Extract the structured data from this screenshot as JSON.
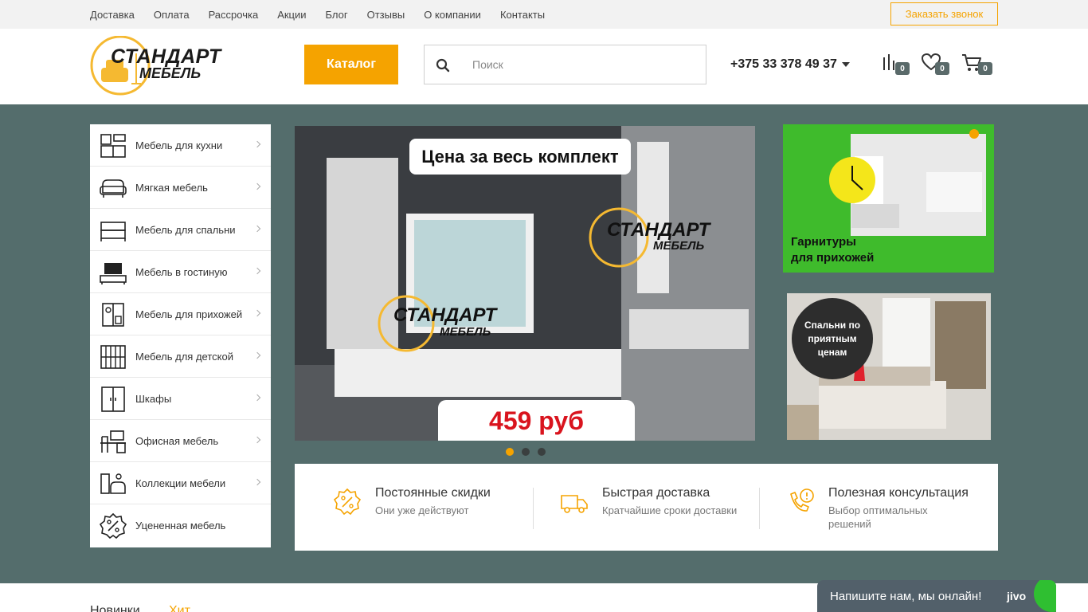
{
  "topbar": {
    "nav": [
      "Доставка",
      "Оплата",
      "Рассрочка",
      "Акции",
      "Блог",
      "Отзывы",
      "О компании",
      "Контакты"
    ],
    "callback_label": "Заказать звонок"
  },
  "header": {
    "logo_line1": "СТАНДАРТ",
    "logo_line2": "МЕБЕЛЬ",
    "catalog_label": "Каталог",
    "search_placeholder": "Поиск",
    "phone": "+375 33 378 49 37",
    "compare_count": "0",
    "favorites_count": "0",
    "cart_count": "0"
  },
  "sidebar": {
    "items": [
      {
        "label": "Мебель для кухни",
        "icon": "kitchen-icon"
      },
      {
        "label": "Мягкая мебель",
        "icon": "sofa-icon"
      },
      {
        "label": "Мебель для спальни",
        "icon": "bed-icon"
      },
      {
        "label": "Мебель в гостиную",
        "icon": "tv-stand-icon"
      },
      {
        "label": "Мебель для прихожей",
        "icon": "hallway-icon"
      },
      {
        "label": "Мебель для детской",
        "icon": "nursery-icon"
      },
      {
        "label": "Шкафы",
        "icon": "wardrobe-icon"
      },
      {
        "label": "Офисная мебель",
        "icon": "office-icon"
      },
      {
        "label": "Коллекции мебели",
        "icon": "collection-icon"
      },
      {
        "label": "Уцененная мебель",
        "icon": "discount-icon"
      }
    ]
  },
  "banner": {
    "title": "Цена за весь комплект",
    "price": "459 руб",
    "logo_line1": "СТАНДАРТ",
    "logo_line2": "МЕБЕЛЬ",
    "slides": 3,
    "active_slide": 1
  },
  "promos": {
    "hallway": "Гарнитуры\nдля прихожей",
    "bedroom": "Спальни по\nприятным\nценам"
  },
  "features": [
    {
      "title": "Постоянные скидки",
      "subtitle": "Они уже действуют",
      "icon": "percent-icon"
    },
    {
      "title": "Быстрая доставка",
      "subtitle": "Кратчайшие сроки доставки",
      "icon": "truck-icon"
    },
    {
      "title": "Полезная консультация",
      "subtitle": "Выбор оптимальных решений",
      "icon": "phone-consult-icon"
    }
  ],
  "tabs": {
    "new": "Новинки",
    "hit": "Хит"
  },
  "chat": {
    "text": "Напишите нам, мы онлайн!",
    "brand": "jivo"
  },
  "colors": {
    "accent": "#f5a300",
    "main_bg": "#546d6c",
    "promo_green": "#3fbb2c",
    "price_red": "#d9141e"
  }
}
